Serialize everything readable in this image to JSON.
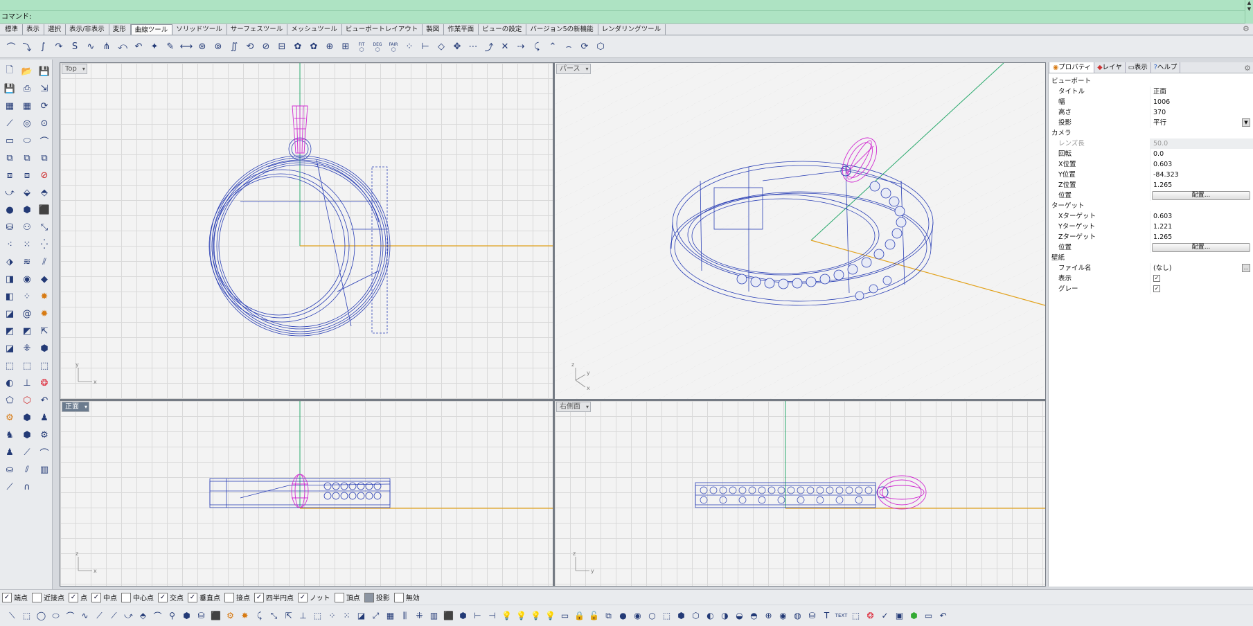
{
  "command": {
    "prompt": "コマンド:"
  },
  "tabs": [
    "標準",
    "表示",
    "選択",
    "表示/非表示",
    "変形",
    "曲線ツール",
    "ソリッドツール",
    "サーフェスツール",
    "メッシュツール",
    "ビューポートレイアウト",
    "製図",
    "作業平面",
    "ビューの設定",
    "バージョン5の新機能",
    "レンダリングツール"
  ],
  "active_tab": "曲線ツール",
  "viewports": {
    "top": {
      "label": "Top",
      "axis": [
        "y",
        "x"
      ]
    },
    "perspective": {
      "label": "パース",
      "axis": [
        "z",
        "y",
        "x"
      ]
    },
    "front": {
      "label": "正面",
      "axis": [
        "z",
        "x"
      ]
    },
    "right": {
      "label": "右側面",
      "axis": [
        "z",
        "y"
      ]
    }
  },
  "cmd_toolbar_text": {
    "fit": "FIT",
    "deg": "DEG",
    "fair": "FAIR"
  },
  "panel": {
    "tabs": [
      "プロパティ",
      "レイヤ",
      "表示",
      "ヘルプ"
    ],
    "viewport_section": "ビューポート",
    "title_label": "タイトル",
    "title_value": "正面",
    "width_label": "幅",
    "width_value": "1006",
    "height_label": "高さ",
    "height_value": "370",
    "projection_label": "投影",
    "projection_value": "平行",
    "camera_section": "カメラ",
    "lens_label": "レンズ長",
    "lens_value": "50.0",
    "rotation_label": "回転",
    "rotation_value": "0.0",
    "xpos_label": "X位置",
    "xpos_value": "0.603",
    "ypos_label": "Y位置",
    "ypos_value": "-84.323",
    "zpos_label": "Z位置",
    "zpos_value": "1.265",
    "position_label": "位置",
    "place_button": "配置...",
    "target_section": "ターゲット",
    "xt_label": "Xターゲット",
    "xt_value": "0.603",
    "yt_label": "Yターゲット",
    "yt_value": "1.221",
    "zt_label": "Zターゲット",
    "zt_value": "1.265",
    "target_pos_label": "位置",
    "target_place_button": "配置...",
    "wallpaper_section": "壁紙",
    "file_label": "ファイル名",
    "file_value": "(なし)",
    "file_button": "...",
    "show_label": "表示",
    "gray_label": "グレー"
  },
  "osnap": [
    {
      "label": "端点",
      "checked": true
    },
    {
      "label": "近接点",
      "checked": false
    },
    {
      "label": "点",
      "checked": true
    },
    {
      "label": "中点",
      "checked": true
    },
    {
      "label": "中心点",
      "checked": false
    },
    {
      "label": "交点",
      "checked": true
    },
    {
      "label": "垂直点",
      "checked": true
    },
    {
      "label": "接点",
      "checked": false
    },
    {
      "label": "四半円点",
      "checked": true
    },
    {
      "label": "ノット",
      "checked": true
    },
    {
      "label": "頂点",
      "checked": false
    },
    {
      "label": "投影",
      "checked": false
    },
    {
      "label": "無効",
      "checked": false
    }
  ],
  "bottom_text": "TEXT",
  "colors": {
    "wire": "#2a3fb5",
    "highlight": "#d12bd1",
    "xaxis": "#e2a21c",
    "yaxis": "#27a86b"
  }
}
